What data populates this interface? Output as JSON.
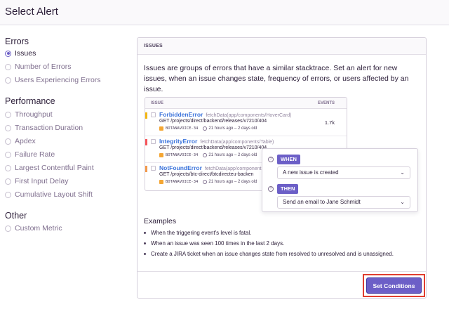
{
  "header": {
    "title": "Select Alert"
  },
  "sidebar": {
    "groups": [
      {
        "title": "Errors",
        "items": [
          {
            "label": "Issues",
            "selected": true
          },
          {
            "label": "Number of Errors",
            "selected": false
          },
          {
            "label": "Users Experiencing Errors",
            "selected": false
          }
        ]
      },
      {
        "title": "Performance",
        "items": [
          {
            "label": "Throughput",
            "selected": false
          },
          {
            "label": "Transaction Duration",
            "selected": false
          },
          {
            "label": "Apdex",
            "selected": false
          },
          {
            "label": "Failure Rate",
            "selected": false
          },
          {
            "label": "Largest Contentful Paint",
            "selected": false
          },
          {
            "label": "First Input Delay",
            "selected": false
          },
          {
            "label": "Cumulative Layout Shift",
            "selected": false
          }
        ]
      },
      {
        "title": "Other",
        "items": [
          {
            "label": "Custom Metric",
            "selected": false
          }
        ]
      }
    ]
  },
  "panel": {
    "header": "ISSUES",
    "description": "Issues are groups of errors that have a similar stacktrace. Set an alert for new issues, when an issue changes state, frequency of errors, or users affected by an issue.",
    "issues_table": {
      "col_issue": "ISSUE",
      "col_events": "EVENTS",
      "rows": [
        {
          "name": "ForbiddenError",
          "fn": "fetchData(app/components/HoverCard)",
          "path": "GET /projects/direct/backend/releases/v7210/404",
          "project": "BOTANAVOICE-34",
          "time": "21 hours ago – 2 days old",
          "events": "1.7k",
          "color": "#f2b712"
        },
        {
          "name": "IntegrityError",
          "fn": "fetchData(app/components/Table)",
          "path": "GET /projects/direct/backend/releases/v7210/404",
          "project": "BOTANAVOICE-34",
          "time": "21 hours ago – 2 days old",
          "events": "",
          "color": "#f55459"
        },
        {
          "name": "NotFoundError",
          "fn": "fetchData(app/components",
          "path": "GET /projects/btc-direct/btcdirecteu-backen",
          "project": "BOTANAVOICE-34",
          "time": "21 hours ago – 2 days old",
          "events": "",
          "color": "#f2994a"
        }
      ]
    },
    "rule": {
      "when_label": "WHEN",
      "when_value": "A new issue is created",
      "then_label": "THEN",
      "then_value": "Send an email to Jane Schmidt"
    },
    "examples": {
      "title": "Examples",
      "items": [
        "When the triggering event's level is fatal.",
        "When an issue was seen 100 times in the last 2 days.",
        "Create a JIRA ticket when an issue changes state from resolved to unresolved and is unassigned."
      ]
    },
    "cta_label": "Set Conditions"
  },
  "colors": {
    "accent": "#6c5fc7",
    "highlight": "#e03e2f",
    "link": "#3d74db"
  }
}
